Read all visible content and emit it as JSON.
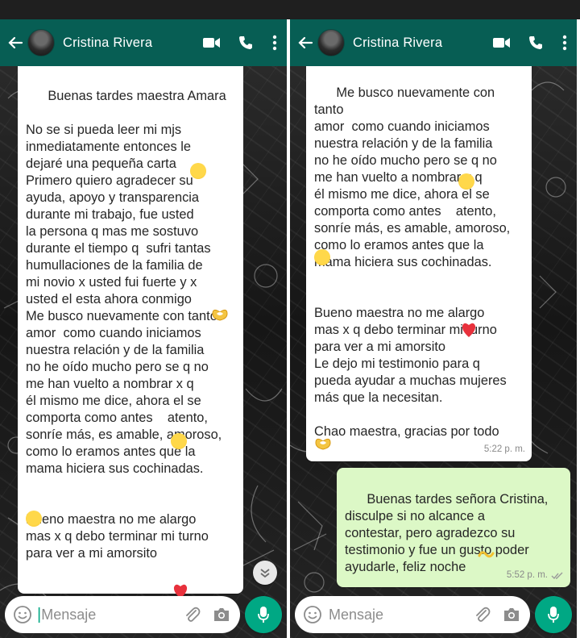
{
  "left_panel": {
    "contact_name": "Cristina Rivera",
    "message": "Buenas tardes maestra Amara\n\nNo se si pueda leer mi mjs\ninmediatamente entonces le\ndejaré una pequeña carta \nPrimero quiero agradecer su\nayuda, apoyo y transparencia\ndurante mi trabajo, fue usted\nla persona q mas me sostuvo\ndurante el tiempo q  sufri tantas\nhumullaciones de la familia de\nmi novio x usted fui fuerte y x\nusted el esta ahora conmigo \nMe busco nuevamente con tanto\namor  como cuando iniciamos\nnuestra relación y de la familia\nno he oído mucho pero se q no\nme han vuelto a nombrar x q\nél mismo me dice, ahora el se\ncomporta como antes    atento,\nsonríe más, es amable, amoroso,\ncomo lo eramos antes que la\nmama hiciera sus cochinadas.\n\n\nBueno maestra no me alargo\nmas x q debo terminar mi turno\npara ver a mi amorsito ",
    "input_placeholder": "Mensaje"
  },
  "right_panel": {
    "contact_name": "Cristina Rivera",
    "incoming": {
      "text": "Me busco nuevamente con tanto\namor  como cuando iniciamos\nnuestra relación y de la familia\nno he oído mucho pero se q no\nme han vuelto a nombrar x q\nél mismo me dice, ahora el se\ncomporta como antes    atento,\nsonríe más, es amable, amoroso,\ncomo lo eramos antes que la\nmama hiciera sus cochinadas.\n\n\nBueno maestra no me alargo\nmas x q debo terminar mi turno\npara ver a mi amorsito \nLe dejo mi testimonio para q\npueda ayudar a muchas mujeres\nmás que la necesitan.\n\nChao maestra, gracias por todo\n",
      "time": "5:22 p. m."
    },
    "outgoing": {
      "text": "Buenas tardes señora Cristina,\ndisculpe si no alcance a\ncontestar, pero agradezco su\ntestimonio y fue un gusto poder\nayudarle, feliz noche ",
      "time": "5:52 p. m."
    },
    "input_placeholder": "Mensaje"
  },
  "icons": [
    "back-arrow-icon",
    "avatar",
    "video-call-icon",
    "phone-icon",
    "more-options-icon",
    "emoji-icon",
    "attach-icon",
    "camera-icon",
    "mic-icon",
    "scroll-down-icon"
  ],
  "colors": {
    "header": "#075e54",
    "outgoing_bubble": "#dcf8c6",
    "incoming_bubble": "#ffffff",
    "mic": "#00a884"
  }
}
